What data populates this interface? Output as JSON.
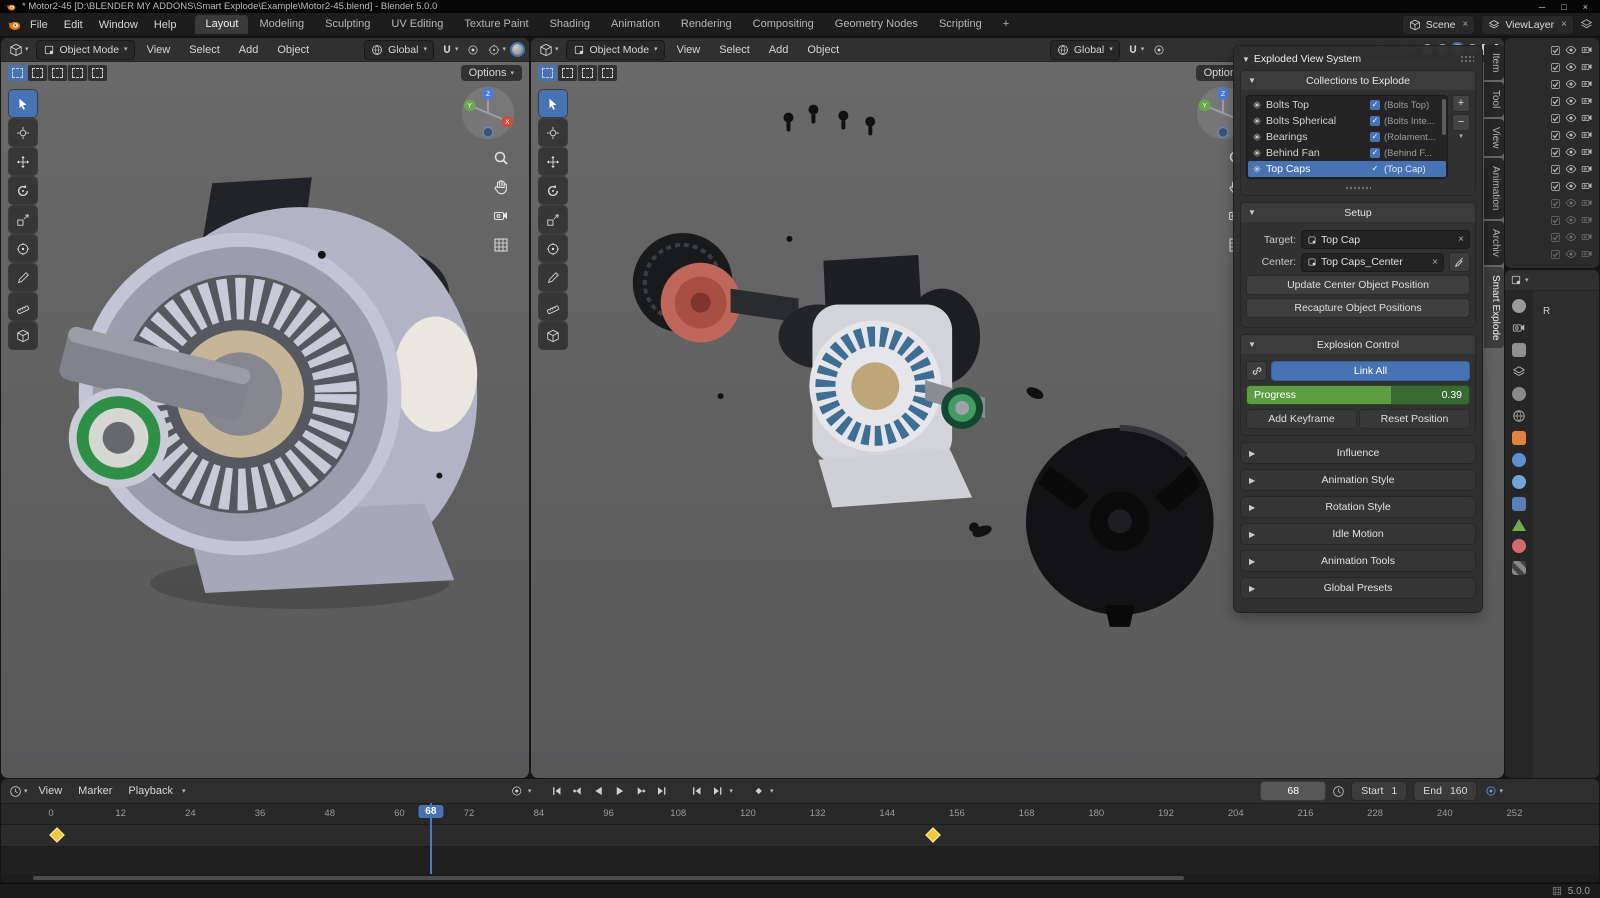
{
  "window": {
    "title": "* Motor2-45 [D:\\BLENDER MY ADDONS\\Smart Explode\\Example\\Motor2-45.blend] - Blender 5.0.0"
  },
  "menubar": {
    "menus": [
      "File",
      "Edit",
      "Window",
      "Help"
    ],
    "workspaces": [
      "Layout",
      "Modeling",
      "Sculpting",
      "UV Editing",
      "Texture Paint",
      "Shading",
      "Animation",
      "Rendering",
      "Compositing",
      "Geometry Nodes",
      "Scripting"
    ],
    "add_tab": "+",
    "scene": "Scene",
    "viewlayer": "ViewLayer"
  },
  "viewport": {
    "mode": "Object Mode",
    "menu_view": "View",
    "menu_select": "Select",
    "menu_add": "Add",
    "menu_object": "Object",
    "orientation": "Global",
    "options": "Options"
  },
  "npanel": {
    "title": "Exploded View System",
    "collections_header": "Collections to Explode",
    "rows": [
      {
        "name": "Bolts Top",
        "tag": "(Bolts Top)"
      },
      {
        "name": "Bolts Spherical",
        "tag": "(Bolts Inte..."
      },
      {
        "name": "Bearings",
        "tag": "(Rolament..."
      },
      {
        "name": "Behind Fan",
        "tag": "(Behind F..."
      },
      {
        "name": "Top Caps",
        "tag": "(Top Cap)"
      }
    ],
    "add_button": "+",
    "remove_button": "−",
    "setup_header": "Setup",
    "target_label": "Target:",
    "target_value": "Top Cap",
    "center_label": "Center:",
    "center_value": "Top Caps_Center",
    "clear_x": "×",
    "update_button": "Update Center Object Position",
    "recapture_button": "Recapture Object Positions",
    "explosion_header": "Explosion Control",
    "link_all": "Link All",
    "progress_label": "Progress",
    "progress_value": "0.39",
    "add_keyframe": "Add Keyframe",
    "reset_position": "Reset Position",
    "sections": [
      "Influence",
      "Animation Style",
      "Rotation Style",
      "Idle Motion",
      "Animation Tools",
      "Global Presets"
    ],
    "tabs": [
      "Item",
      "Tool",
      "View",
      "Animation",
      "Archiv",
      "Smart Explode"
    ]
  },
  "props": {
    "r_label": "R"
  },
  "timeline": {
    "menu_view": "View",
    "menu_marker": "Marker",
    "menu_playback": "Playback",
    "current_frame": "68",
    "start_label": "Start",
    "start_value": "1",
    "end_label": "End",
    "end_value": "160",
    "ticks": [
      "0",
      "12",
      "24",
      "36",
      "48",
      "60",
      "72",
      "84",
      "96",
      "108",
      "120",
      "132",
      "144",
      "156",
      "168",
      "180",
      "192",
      "204",
      "216",
      "228",
      "240",
      "252"
    ]
  },
  "statusbar": {
    "version": "5.0.0"
  }
}
